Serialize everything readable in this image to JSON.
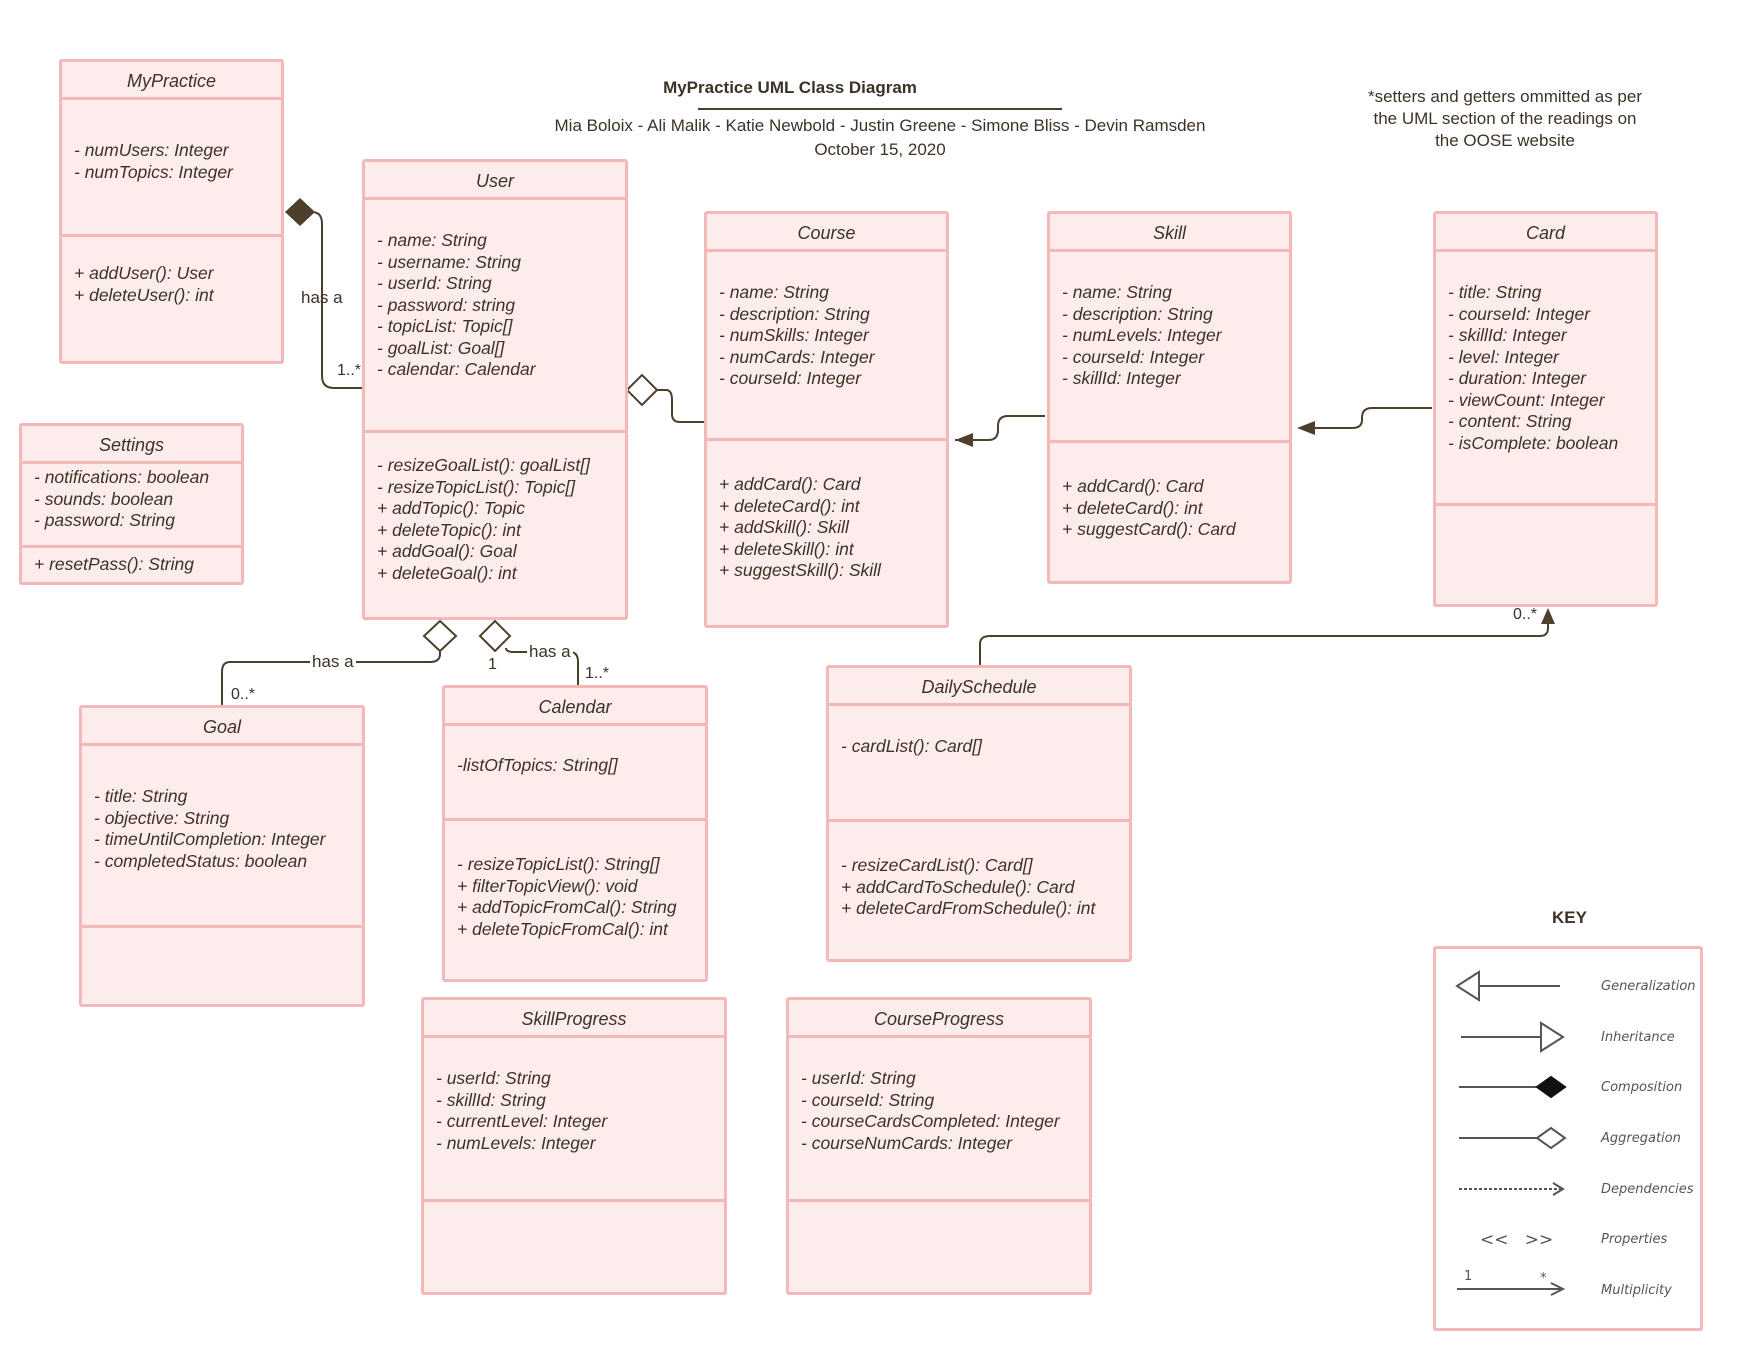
{
  "header": {
    "title": "MyPractice UML Class Diagram",
    "authors": "Mia Boloix - Ali Malik - Katie Newbold - Justin Greene - Simone Bliss - Devin Ramsden",
    "date": "October 15, 2020",
    "note_lines": [
      "*setters and getters ommitted as per",
      "the UML section of the readings on",
      "the OOSE website"
    ]
  },
  "colors": {
    "box_fill": "#fdecec",
    "box_border": "#f4b8b8",
    "line": "#4e3e2c",
    "text": "#3d3226"
  },
  "classes": {
    "mypractice": {
      "name": "MyPractice",
      "attributes": [
        "- numUsers: Integer",
        "- numTopics: Integer"
      ],
      "methods": [
        "+ addUser(): User",
        "+ deleteUser(): int"
      ]
    },
    "settings": {
      "name": "Settings",
      "attributes": [
        "- notifications: boolean",
        "- sounds: boolean",
        "- password: String"
      ],
      "methods": [
        "+ resetPass(): String"
      ]
    },
    "user": {
      "name": "User",
      "attributes": [
        "- name: String",
        "- username: String",
        "- userId: String",
        "- password: string",
        "- topicList: Topic[]",
        "- goalList: Goal[]",
        "- calendar: Calendar"
      ],
      "methods": [
        "- resizeGoalList(): goalList[]",
        "- resizeTopicList(): Topic[]",
        "+ addTopic(): Topic",
        "+ deleteTopic(): int",
        "+ addGoal(): Goal",
        "+ deleteGoal(): int"
      ]
    },
    "course": {
      "name": "Course",
      "attributes": [
        "- name: String",
        "- description: String",
        "- numSkills: Integer",
        "- numCards: Integer",
        "- courseId: Integer"
      ],
      "methods": [
        "+ addCard(): Card",
        "+ deleteCard(): int",
        "+ addSkill(): Skill",
        "+ deleteSkill(): int",
        "+ suggestSkill(): Skill"
      ]
    },
    "skill": {
      "name": "Skill",
      "attributes": [
        "- name: String",
        "- description: String",
        "- numLevels: Integer",
        "- courseId: Integer",
        "- skillId: Integer"
      ],
      "methods": [
        "+ addCard(): Card",
        "+ deleteCard(): int",
        "+ suggestCard(): Card"
      ]
    },
    "card": {
      "name": "Card",
      "attributes": [
        "- title: String",
        "- courseId: Integer",
        "- skillId: Integer",
        "- level: Integer",
        "- duration: Integer",
        "- viewCount: Integer",
        "- content: String",
        "- isComplete: boolean"
      ],
      "methods": []
    },
    "goal": {
      "name": "Goal",
      "attributes": [
        "- title: String",
        "- objective: String",
        "- timeUntilCompletion: Integer",
        "- completedStatus: boolean"
      ],
      "methods": []
    },
    "calendar": {
      "name": "Calendar",
      "attributes": [
        "-listOfTopics: String[]"
      ],
      "methods": [
        "- resizeTopicList(): String[]",
        "+ filterTopicView(): void",
        "+ addTopicFromCal(): String",
        "+ deleteTopicFromCal(): int"
      ]
    },
    "dailyschedule": {
      "name": "DailySchedule",
      "attributes": [
        "- cardList(): Card[]"
      ],
      "methods": [
        "- resizeCardList(): Card[]",
        "+ addCardToSchedule(): Card",
        "+ deleteCardFromSchedule(): int"
      ]
    },
    "skillprogress": {
      "name": "SkillProgress",
      "attributes": [
        "- userId: String",
        "- skillId: String",
        "- currentLevel: Integer",
        "- numLevels: Integer"
      ],
      "methods": []
    },
    "courseprogress": {
      "name": "CourseProgress",
      "attributes": [
        "- userId: String",
        "- courseId: String",
        "- courseCardsCompleted: Integer",
        "- courseNumCards: Integer"
      ],
      "methods": []
    }
  },
  "relations": {
    "mypractice_user": {
      "label": "has a",
      "multiplicity": "1..*"
    },
    "user_goal": {
      "label": "has a",
      "multiplicity": "0..*"
    },
    "user_calendar": {
      "label": "has a",
      "source_multiplicity": "1",
      "multiplicity": "1..*"
    },
    "schedule_card": {
      "multiplicity": "0..*"
    }
  },
  "key": {
    "title": "KEY",
    "items": [
      "Generalization",
      "Inheritance",
      "Composition",
      "Aggregation",
      "Dependencies",
      "Properties",
      "Multiplicity"
    ],
    "properties_symbol": "<<   >>",
    "mult_one": "1",
    "mult_many": "*"
  }
}
